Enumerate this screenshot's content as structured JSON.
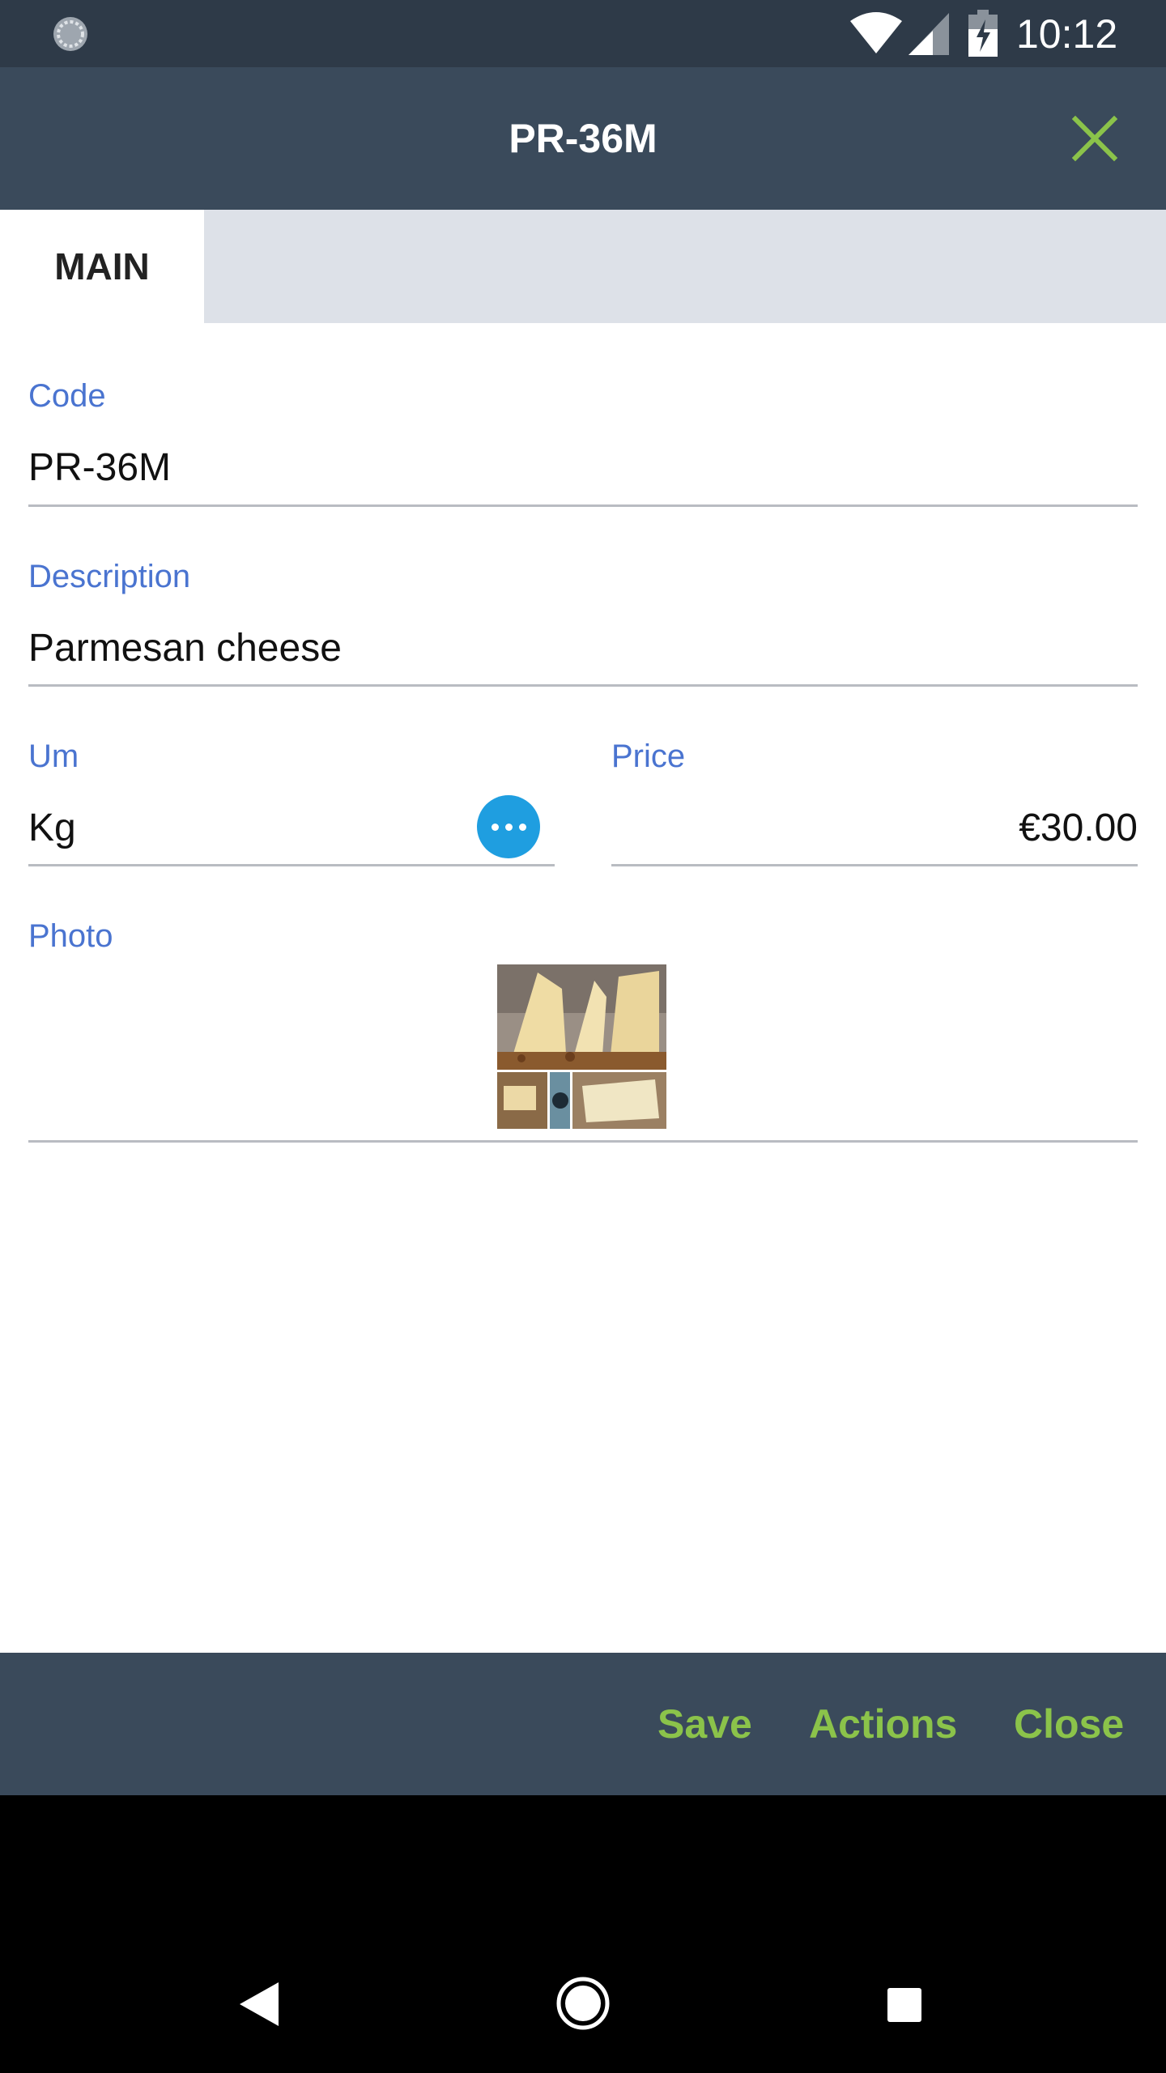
{
  "status_bar": {
    "time": "10:12",
    "icons": [
      "sync-icon",
      "wifi-icon",
      "cell-signal-icon",
      "battery-charging-icon"
    ]
  },
  "app_bar": {
    "title": "PR-36M",
    "close_icon": "close-icon"
  },
  "tabs": [
    {
      "label": "MAIN",
      "selected": true
    }
  ],
  "form": {
    "code": {
      "label": "Code",
      "value": "PR-36M"
    },
    "description": {
      "label": "Description",
      "value": "Parmesan cheese"
    },
    "um": {
      "label": "Um",
      "value": "Kg",
      "lookup_icon": "more-horizontal-icon"
    },
    "price": {
      "label": "Price",
      "value": "€30.00"
    },
    "photo": {
      "label": "Photo",
      "image": "parmesan-cheese-photo"
    }
  },
  "footer": {
    "save_label": "Save",
    "actions_label": "Actions",
    "close_label": "Close"
  },
  "nav_bar": {
    "icons": [
      "back-icon",
      "home-icon",
      "recents-icon"
    ]
  },
  "colors": {
    "app_bar": "#3a4a5b",
    "status_bar": "#2e3a48",
    "accent_green": "#8bc34a",
    "label_blue": "#4a74d0",
    "lookup_button": "#1f9ee0",
    "tab_bar": "#dde1e8"
  }
}
